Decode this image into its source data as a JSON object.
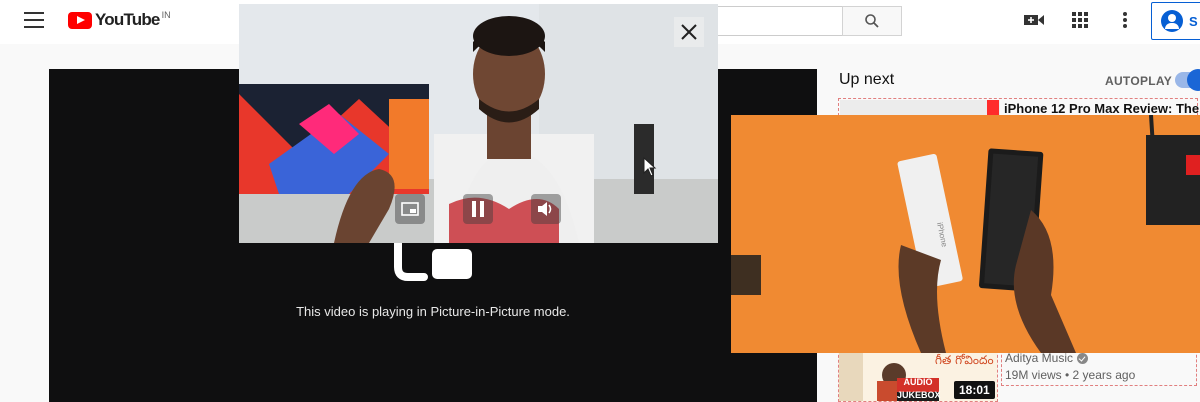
{
  "header": {
    "logo_text": "YouTube",
    "country_code": "IN",
    "signin_label": "S",
    "icons": [
      "menu-icon",
      "search-icon",
      "video-camera-icon",
      "apps-grid-icon",
      "more-vert-icon",
      "account-icon"
    ]
  },
  "player": {
    "pip_message": "This video is playing in Picture-in-Picture mode."
  },
  "sidebar": {
    "up_next_label": "Up next",
    "autoplay_label": "AUTOPLAY",
    "autoplay_on": true,
    "recommendations": [
      {
        "title": "iPhone 12 Pro Max Review: The"
      },
      {
        "thumb_text_telugu": "గీత గోవిందం",
        "badge_line1": "AUDIO",
        "badge_line2": "JUKEBOX",
        "channel": "Aditya Music",
        "meta": "19M views • 2 years ago",
        "duration": "18:01"
      }
    ]
  },
  "pip_window": {
    "controls": [
      "pip-exit-icon",
      "pause-icon",
      "volume-icon"
    ],
    "close_icon": "close-icon"
  },
  "overlay_image": {
    "box_text": "iPhone"
  },
  "colors": {
    "brand_red": "#ff0000",
    "accent_blue": "#065fd4",
    "player_bg": "#0f0f10",
    "overlay_orange": "#f0872d"
  }
}
